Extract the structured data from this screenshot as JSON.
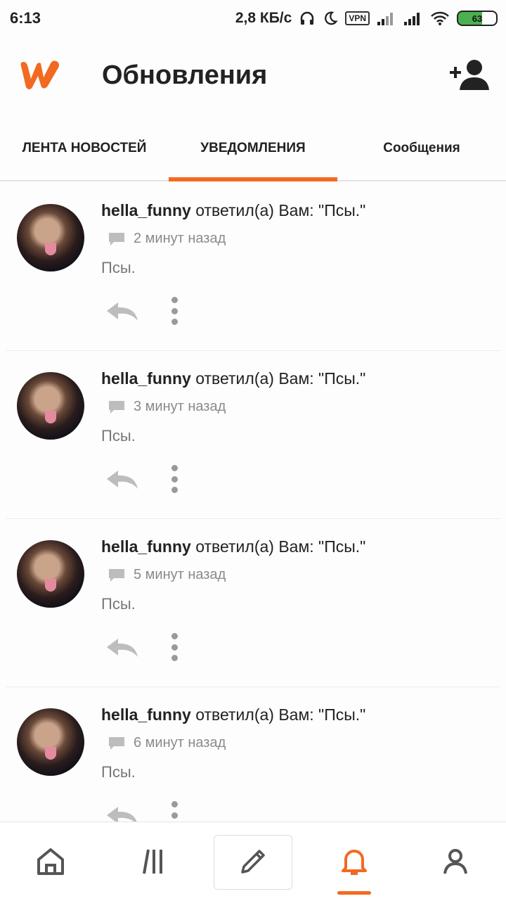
{
  "status_bar": {
    "time": "6:13",
    "speed": "2,8 КБ/с",
    "vpn": "VPN",
    "battery": "63"
  },
  "app_bar": {
    "title": "Обновления",
    "brand_color": "#f26a21"
  },
  "tabs": [
    {
      "label": "ЛЕНТА НОВОСТЕЙ",
      "active": false
    },
    {
      "label": "УВЕДОМЛЕНИЯ",
      "active": true
    },
    {
      "label": "Сообщения",
      "active": false
    }
  ],
  "notifications": [
    {
      "user": "hella_funny",
      "action": " ответил(а) Вам: \"Псы.\"",
      "time": "2 минут назад",
      "text": "Псы."
    },
    {
      "user": "hella_funny",
      "action": " ответил(а) Вам: \"Псы.\"",
      "time": "3 минут назад",
      "text": "Псы."
    },
    {
      "user": "hella_funny",
      "action": " ответил(а) Вам: \"Псы.\"",
      "time": "5 минут назад",
      "text": "Псы."
    },
    {
      "user": "hella_funny",
      "action": " ответил(а) Вам: \"Псы.\"",
      "time": "6 минут назад",
      "text": "Псы."
    }
  ],
  "bottom_nav": [
    {
      "icon": "home-icon",
      "active": false
    },
    {
      "icon": "library-icon",
      "active": false
    },
    {
      "icon": "pencil-icon",
      "active": false
    },
    {
      "icon": "bell-icon",
      "active": true
    },
    {
      "icon": "profile-icon",
      "active": false
    }
  ]
}
